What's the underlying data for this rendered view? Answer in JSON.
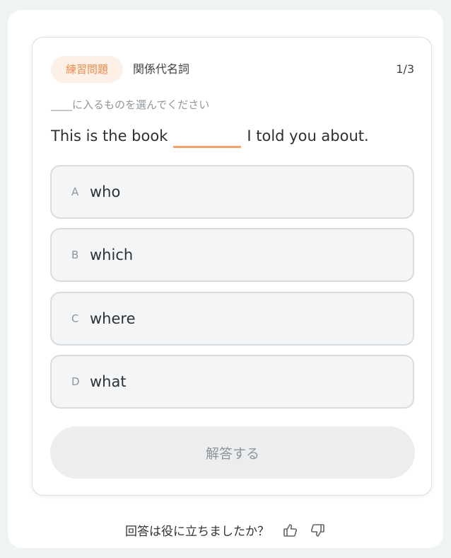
{
  "header": {
    "tag": "練習問題",
    "category": "関係代名詞",
    "progress": "1/3"
  },
  "question": {
    "instruction": "____に入るものを選んでください",
    "before": "This is the book",
    "after": "I told you about."
  },
  "options": [
    {
      "letter": "A",
      "text": "who"
    },
    {
      "letter": "B",
      "text": "which"
    },
    {
      "letter": "C",
      "text": "where"
    },
    {
      "letter": "D",
      "text": "what"
    }
  ],
  "submit_label": "解答する",
  "feedback": {
    "prompt": "回答は役に立ちましたか？",
    "icons": [
      "thumbs-up-icon",
      "thumbs-down-icon"
    ]
  },
  "colors": {
    "accent": "#f28a4a",
    "accent_bg": "#fdf0e6",
    "blank": "#f5a06a"
  }
}
